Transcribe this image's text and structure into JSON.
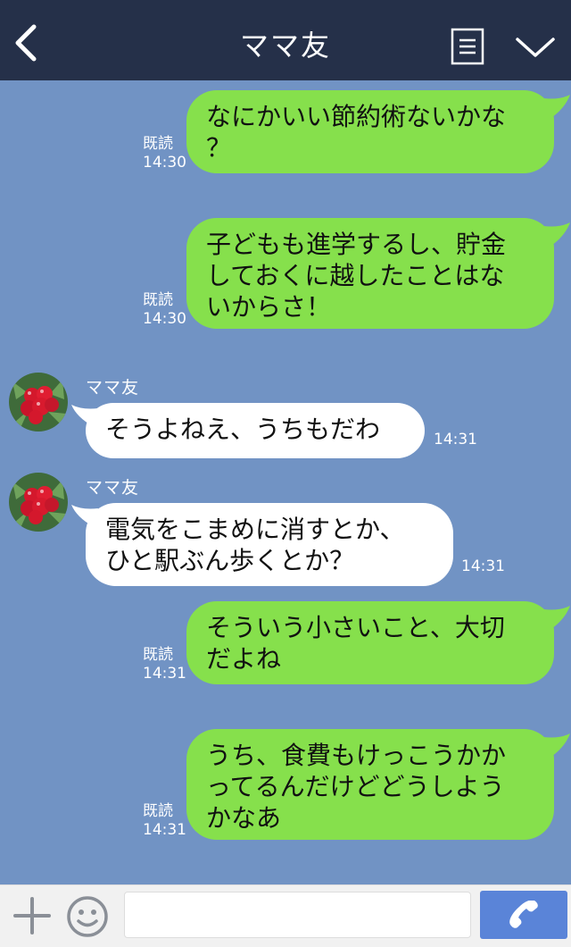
{
  "header": {
    "title": "ママ友"
  },
  "messages": [
    {
      "direction": "sent",
      "text_lines": [
        "なにかいい節約術ないかな",
        "？"
      ],
      "read_label": "既読",
      "time": "14:30"
    },
    {
      "direction": "sent",
      "text_lines": [
        "子どもも進学するし、貯金",
        "しておくに越したことはな",
        "いからさ！"
      ],
      "read_label": "既読",
      "time": "14:30"
    },
    {
      "direction": "received",
      "sender": "ママ友",
      "text_lines": [
        "そうよねえ、うちもだわ"
      ],
      "time": "14:31"
    },
    {
      "direction": "received",
      "sender": "ママ友",
      "text_lines": [
        "電気をこまめに消すとか、",
        "ひと駅ぶん歩くとか？"
      ],
      "time": "14:31"
    },
    {
      "direction": "sent",
      "text_lines": [
        "そういう小さいこと、大切",
        "だよね"
      ],
      "read_label": "既読",
      "time": "14:31"
    },
    {
      "direction": "sent",
      "text_lines": [
        "うち、食費もけっこうかか",
        "ってるんだけどどうしよう",
        "かなあ"
      ],
      "read_label": "既読",
      "time": "14:31"
    }
  ],
  "footer": {
    "input_value": ""
  },
  "colors": {
    "header": "#253049",
    "background": "#7193c4",
    "sent_bubble": "#86e04c",
    "received_bubble": "#ffffff",
    "send_button": "#5a84d8"
  }
}
